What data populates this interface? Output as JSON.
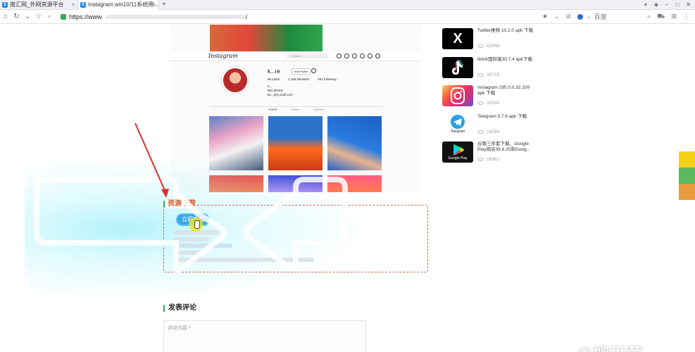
{
  "browser": {
    "tabs": [
      {
        "label": "南汇网_外网资源平台",
        "active": false
      },
      {
        "label": "Instagram win10/11系统用...",
        "active": true
      }
    ],
    "new_tab": "+",
    "url_prefix": "https://www",
    "url_suffix": "/",
    "search_engine": "百度"
  },
  "embedded_instagram": {
    "logo": "Instagram",
    "search_placeholder": "Search",
    "username": "k...re",
    "edit_profile": "Edit Profile",
    "stats": [
      "86 posts",
      "1,165 followers",
      "461 following"
    ],
    "bio": [
      "k...",
      "BIG BOSS",
      "ke...@ry.mail.com"
    ],
    "tabs": [
      "POSTS",
      "SAVED",
      "TAGGED"
    ]
  },
  "download": {
    "title": "资源下载",
    "button": "立即下载"
  },
  "comments": {
    "title": "发表评论",
    "placeholder": "评论内容 *"
  },
  "sidebar": {
    "items": [
      {
        "icon": "x-icon",
        "icon_text": "X",
        "title": "Twitter推特 10.2.0 apk 下载",
        "views": "62948"
      },
      {
        "icon": "tiktok-icon",
        "title": "tiktok国际版30.7.4 apk下载",
        "views": "35718"
      },
      {
        "icon": "instagram-icon",
        "title": "Instagram 295.0.0.32.109 apk 下载",
        "views": "32549"
      },
      {
        "icon": "telegram-icon",
        "icon_text": "Telegram",
        "title": "Telegram 9.7.6 apk 下载",
        "views": "18296"
      },
      {
        "icon": "google-play-icon",
        "icon_text": "Google Play",
        "title": "谷歌三件套下载、Google Play商店36.6.25和Goog...",
        "views": "16362"
      }
    ]
  },
  "watermark": "@柳世茵",
  "colors": {
    "accent_green": "#3aa757",
    "download_orange": "#d0602a",
    "button_blue": "#3da6e6",
    "arrow_red": "#e0302a"
  }
}
